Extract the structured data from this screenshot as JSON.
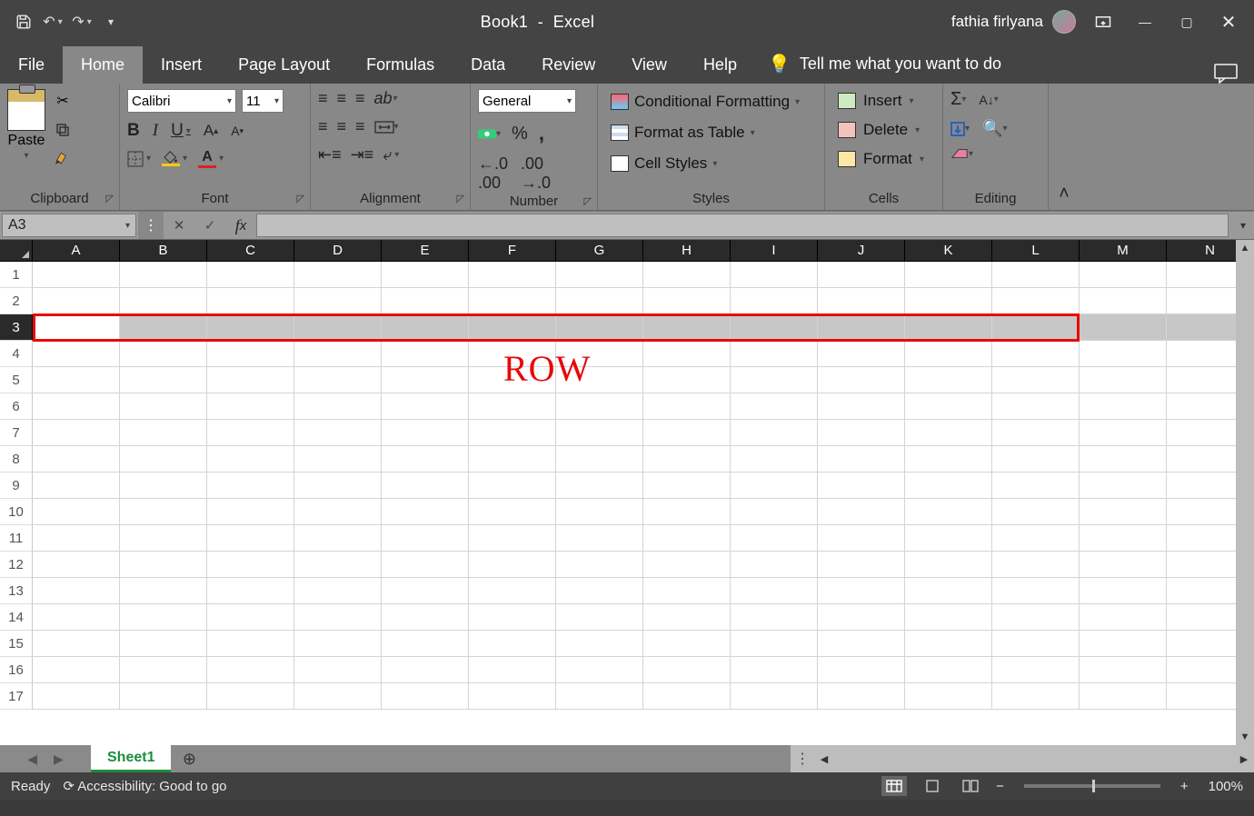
{
  "title": {
    "document": "Book1",
    "separator": "-",
    "app": "Excel"
  },
  "user": {
    "name": "fathia firlyana"
  },
  "tabs": [
    "File",
    "Home",
    "Insert",
    "Page Layout",
    "Formulas",
    "Data",
    "Review",
    "View",
    "Help"
  ],
  "active_tab": "Home",
  "tell_me": "Tell me what you want to do",
  "ribbon": {
    "clipboard": {
      "paste": "Paste",
      "label": "Clipboard"
    },
    "font": {
      "name": "Calibri",
      "size": "11",
      "label": "Font"
    },
    "alignment": {
      "label": "Alignment"
    },
    "number": {
      "format": "General",
      "label": "Number"
    },
    "styles": {
      "conditional": "Conditional Formatting",
      "table": "Format as Table",
      "cell": "Cell Styles",
      "label": "Styles"
    },
    "cells": {
      "insert": "Insert",
      "delete": "Delete",
      "format": "Format",
      "label": "Cells"
    },
    "editing": {
      "label": "Editing"
    }
  },
  "name_box": "A3",
  "columns": [
    "A",
    "B",
    "C",
    "D",
    "E",
    "F",
    "G",
    "H",
    "I",
    "J",
    "K",
    "L",
    "M",
    "N"
  ],
  "rows": [
    "1",
    "2",
    "3",
    "4",
    "5",
    "6",
    "7",
    "8",
    "9",
    "10",
    "11",
    "12",
    "13",
    "14",
    "15",
    "16",
    "17"
  ],
  "selected_row": "3",
  "annotation": "ROW",
  "sheet": {
    "active": "Sheet1"
  },
  "status": {
    "ready": "Ready",
    "accessibility": "Accessibility: Good to go",
    "zoom": "100%"
  }
}
